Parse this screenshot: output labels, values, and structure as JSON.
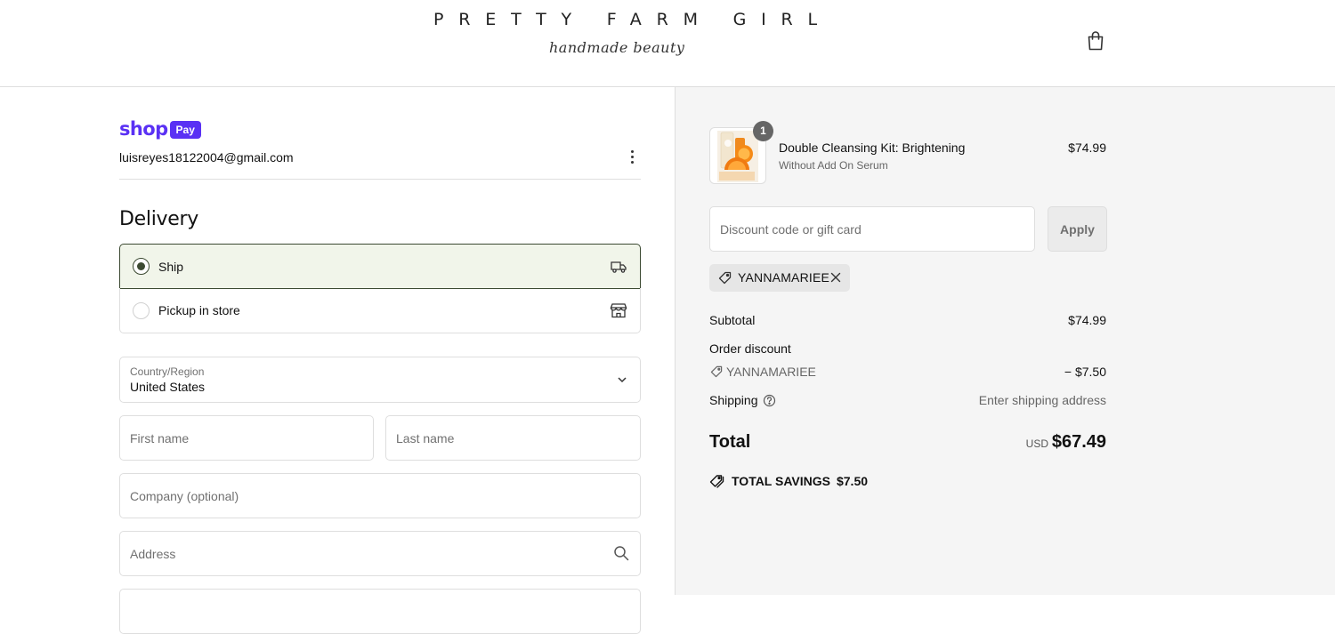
{
  "brand": {
    "name": "PRETTY FARM GIRL",
    "tagline": "handmade beauty"
  },
  "account": {
    "shop_word": "shop",
    "pay_badge": "Pay",
    "email": "luisreyes18122004@gmail.com"
  },
  "delivery": {
    "title": "Delivery",
    "options": [
      {
        "label": "Ship",
        "selected": true,
        "icon": "truck-icon"
      },
      {
        "label": "Pickup in store",
        "selected": false,
        "icon": "store-icon"
      }
    ]
  },
  "form": {
    "country_label": "Country/Region",
    "country_value": "United States",
    "first_name_placeholder": "First name",
    "last_name_placeholder": "Last name",
    "company_placeholder": "Company (optional)",
    "address_placeholder": "Address"
  },
  "order": {
    "item": {
      "quantity": "1",
      "name": "Double Cleansing Kit: Brightening",
      "variant": "Without Add On Serum",
      "price": "$74.99"
    },
    "discount_placeholder": "Discount code or gift card",
    "apply_label": "Apply",
    "applied_code": "YANNAMARIEE",
    "subtotal_label": "Subtotal",
    "subtotal_value": "$74.99",
    "order_discount_label": "Order discount",
    "discount_code": "YANNAMARIEE",
    "discount_value": "− $7.50",
    "shipping_label": "Shipping",
    "shipping_value": "Enter shipping address",
    "total_label": "Total",
    "currency": "USD",
    "total_value": "$67.49",
    "savings_label": "TOTAL SAVINGS",
    "savings_value": "$7.50"
  },
  "colors": {
    "shop_pay": "#5a31f4",
    "selected_option_bg": "#f1f5ea",
    "selected_option_border": "#3c4a32",
    "summary_bg": "#f5f5f5"
  }
}
